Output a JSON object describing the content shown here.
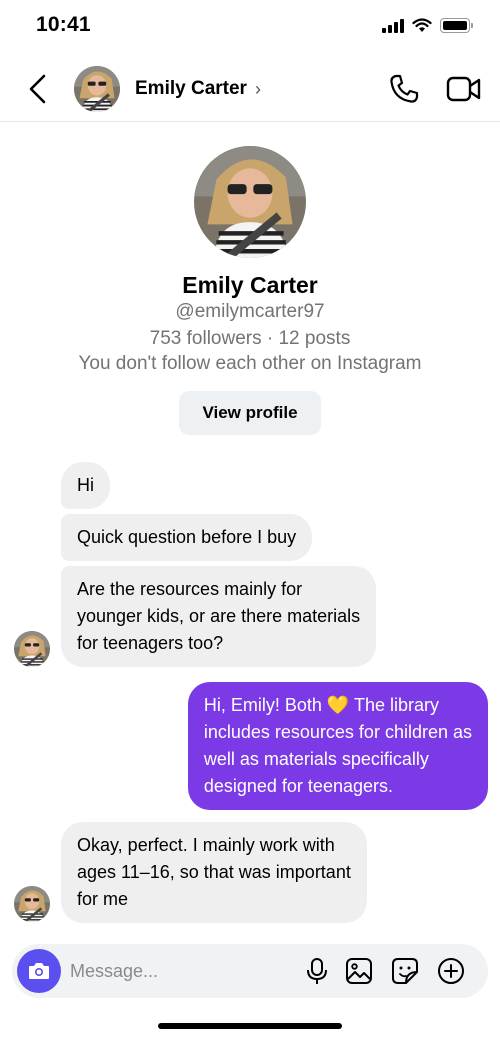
{
  "status_bar": {
    "time": "10:41",
    "icons": [
      "signal-icon",
      "wifi-icon",
      "battery-icon"
    ]
  },
  "header": {
    "name": "Emily Carter",
    "chevron": "›",
    "icons": [
      "back-chevron-icon",
      "phone-icon",
      "video-camera-icon"
    ]
  },
  "profile": {
    "name": "Emily Carter",
    "handle": "@emilymcarter97",
    "stats": "753 followers · 12 posts",
    "follow_status": "You don't follow each other on Instagram",
    "view_profile_label": "View profile"
  },
  "messages": [
    {
      "direction": "incoming",
      "lines": [
        "Hi"
      ]
    },
    {
      "direction": "incoming",
      "lines": [
        "Quick question before I buy"
      ]
    },
    {
      "direction": "incoming",
      "lines": [
        "Are the resources mainly for",
        "younger kids, or are there materials",
        "for teenagers too?"
      ]
    },
    {
      "direction": "outgoing",
      "lines": [
        "Hi, Emily! Both 💛 The library",
        "includes resources for children as",
        "well as materials specifically",
        "designed for teenagers."
      ]
    },
    {
      "direction": "incoming",
      "lines": [
        "Okay, perfect. I mainly work with",
        "ages 11–16, so that was important",
        "for me"
      ]
    }
  ],
  "composer": {
    "placeholder": "Message...",
    "icons": [
      "camera-icon",
      "microphone-icon",
      "gallery-icon",
      "sticker-icon",
      "plus-circle-icon"
    ]
  },
  "colors": {
    "outgoing_bubble": "#7b3ae6",
    "incoming_bubble": "#efefef",
    "camera_button": "#5b4ff0",
    "secondary_text": "#737373"
  }
}
